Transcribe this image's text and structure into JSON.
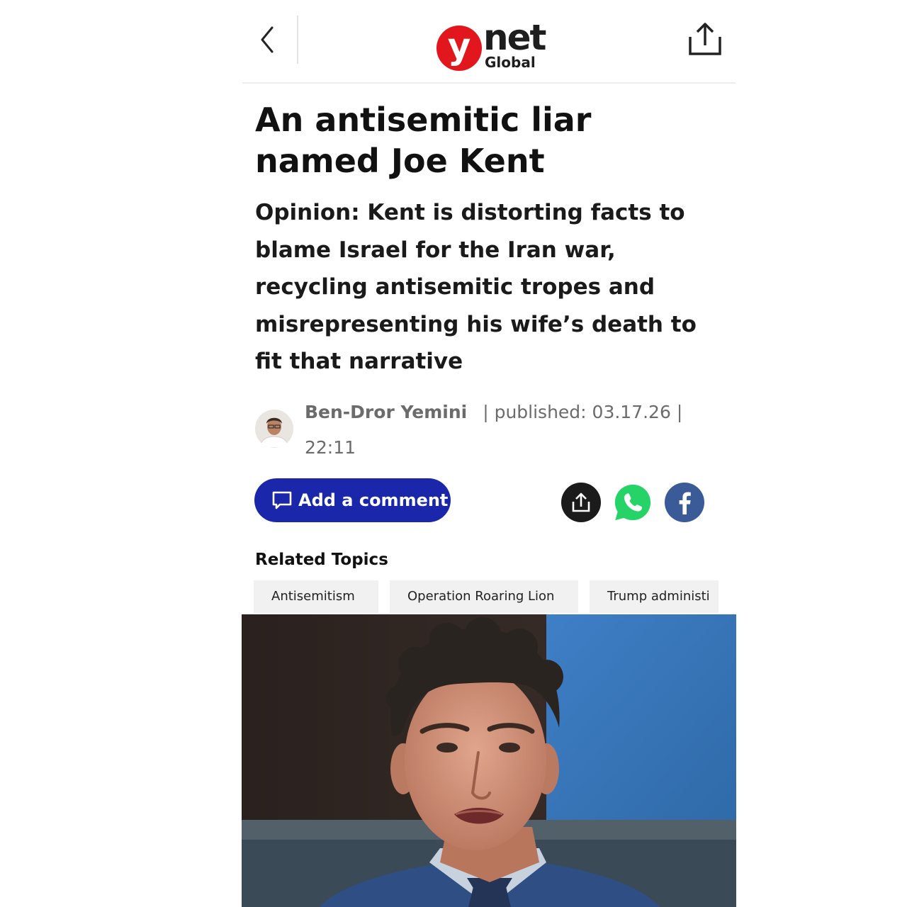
{
  "colors": {
    "accent": "#1a27ab",
    "logo_red": "#e2171d",
    "whatsapp": "#25d366",
    "facebook": "#3b5a98",
    "byline_gray": "#6b6b6b",
    "topic_bg": "#f1f1f1"
  },
  "header": {
    "back_icon": "chevron-left-icon",
    "logo": {
      "letter": "y",
      "word": "net",
      "sub": "Global"
    },
    "share_icon": "share-icon"
  },
  "article": {
    "headline": "An antisemitic liar named Joe Kent",
    "subheadline": "Opinion: Kent is distorting facts to blame Israel for the Iran war, recycling antisemitic tropes and misrepresenting his wife’s death to fit that narrative",
    "author": "Ben-Dror Yemini",
    "published_label": "published: 03.17.26",
    "separator": "|",
    "time": "22:11"
  },
  "actions": {
    "comment_label": "Add a comment",
    "comment_icon": "comment-icon",
    "share_icon": "share-icon",
    "whatsapp_icon": "whatsapp-icon",
    "facebook_icon": "facebook-icon"
  },
  "related": {
    "title": "Related Topics",
    "topics": [
      "Antisemitism",
      "Operation Roaring Lion",
      "Trump administi"
    ]
  }
}
